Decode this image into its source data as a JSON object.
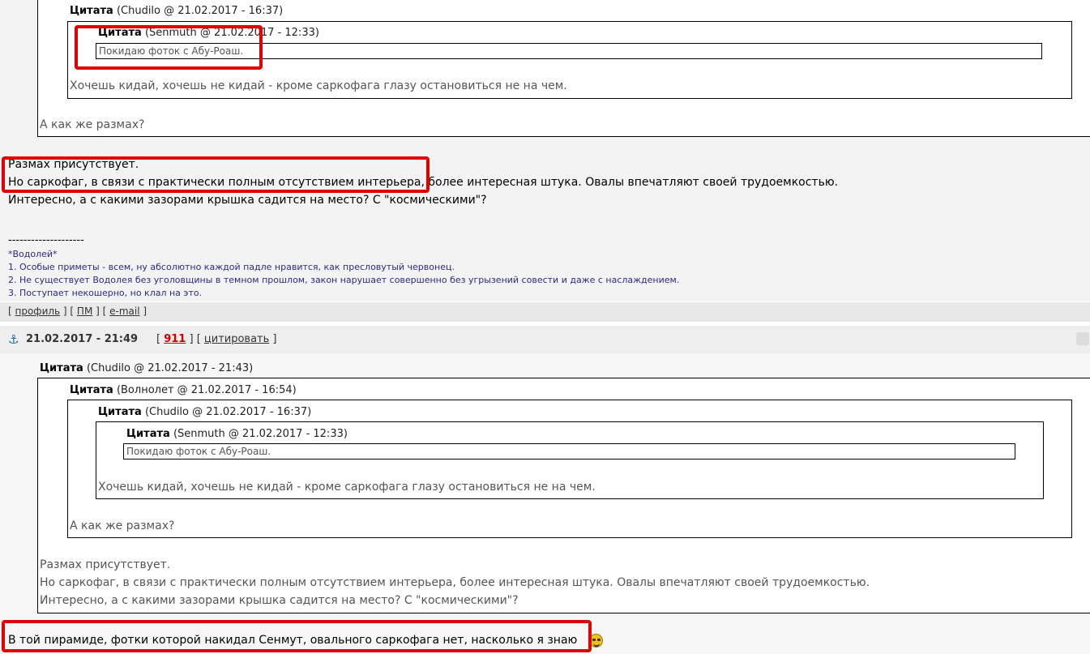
{
  "top_post": {
    "outer_quote": {
      "header_label": "Цитата",
      "header_meta": "(Chudilo @ 21.02.2017 - 16:37)",
      "inner_quote": {
        "header_label": "Цитата",
        "header_meta": "(Senmuth @ 21.02.2017 - 12:33)",
        "text": "Покидаю фоток с Абу-Роаш."
      },
      "text": "Хочешь кидай, хочешь не кидай - кроме саркофага глазу остановиться не на чем."
    },
    "tail_text": "А как же размах?",
    "body_lines": [
      "Размах присутствует.",
      "Но саркофаг, в связи с практически полным отсутствием интерьера, более интересная штука. Овалы впечатляют своей трудоемкостью.",
      "Интересно, а с какими зазорами крышка садится на место? С \"космическими\"?"
    ],
    "signature": {
      "divider": "--------------------",
      "title": "*Водолей*",
      "lines": [
        "1. Особые приметы - всем, ну абсолютно каждой падле нравится, как пресловутый червонец.",
        "2. Не существует Водолея без уголовщины в темном прошлом, закон нарушает совершенно без угрызений совести и даже с наслаждением.",
        "3. Поступает некошерно, но клал на это."
      ]
    },
    "links": {
      "profile": "профиль",
      "pm": "ПМ",
      "email": "e-mail"
    }
  },
  "bottom_post": {
    "anchor_icon": "anchor-icon",
    "datetime": "21.02.2017 - 21:49",
    "post_number": "911",
    "quote_action": "цитировать",
    "q1": {
      "header_label": "Цитата",
      "header_meta": "(Chudilo @ 21.02.2017 - 21:43)"
    },
    "q2": {
      "header_label": "Цитата",
      "header_meta": "(Волнолет @ 21.02.2017 - 16:54)"
    },
    "q3": {
      "header_label": "Цитата",
      "header_meta": "(Chudilo @ 21.02.2017 - 16:37)",
      "text": "Хочешь кидай, хочешь не кидай - кроме саркофага глазу остановиться не на чем."
    },
    "q4": {
      "header_label": "Цитата",
      "header_meta": "(Senmuth @ 21.02.2017 - 12:33)",
      "text": "Покидаю фоток с Абу-Роаш."
    },
    "q2_text": "А как же размах?",
    "q1_lines": [
      "Размах присутствует.",
      "Но саркофаг, в связи с практически полным отсутствием интерьера, более интересная штука. Овалы впечатляют своей трудоемкостью.",
      "Интересно, а с какими зазорами крышка садится на место? С \"космическими\"?"
    ],
    "reply_text": "В той пирамиде, фотки которой накидал Сенмут, овального саркофага нет, насколько я знаю",
    "smiley_icon": "smiley-icon"
  },
  "colors": {
    "highlight": "#e00000",
    "post_number": "#cc0000",
    "signature": "#2a2a8a"
  }
}
